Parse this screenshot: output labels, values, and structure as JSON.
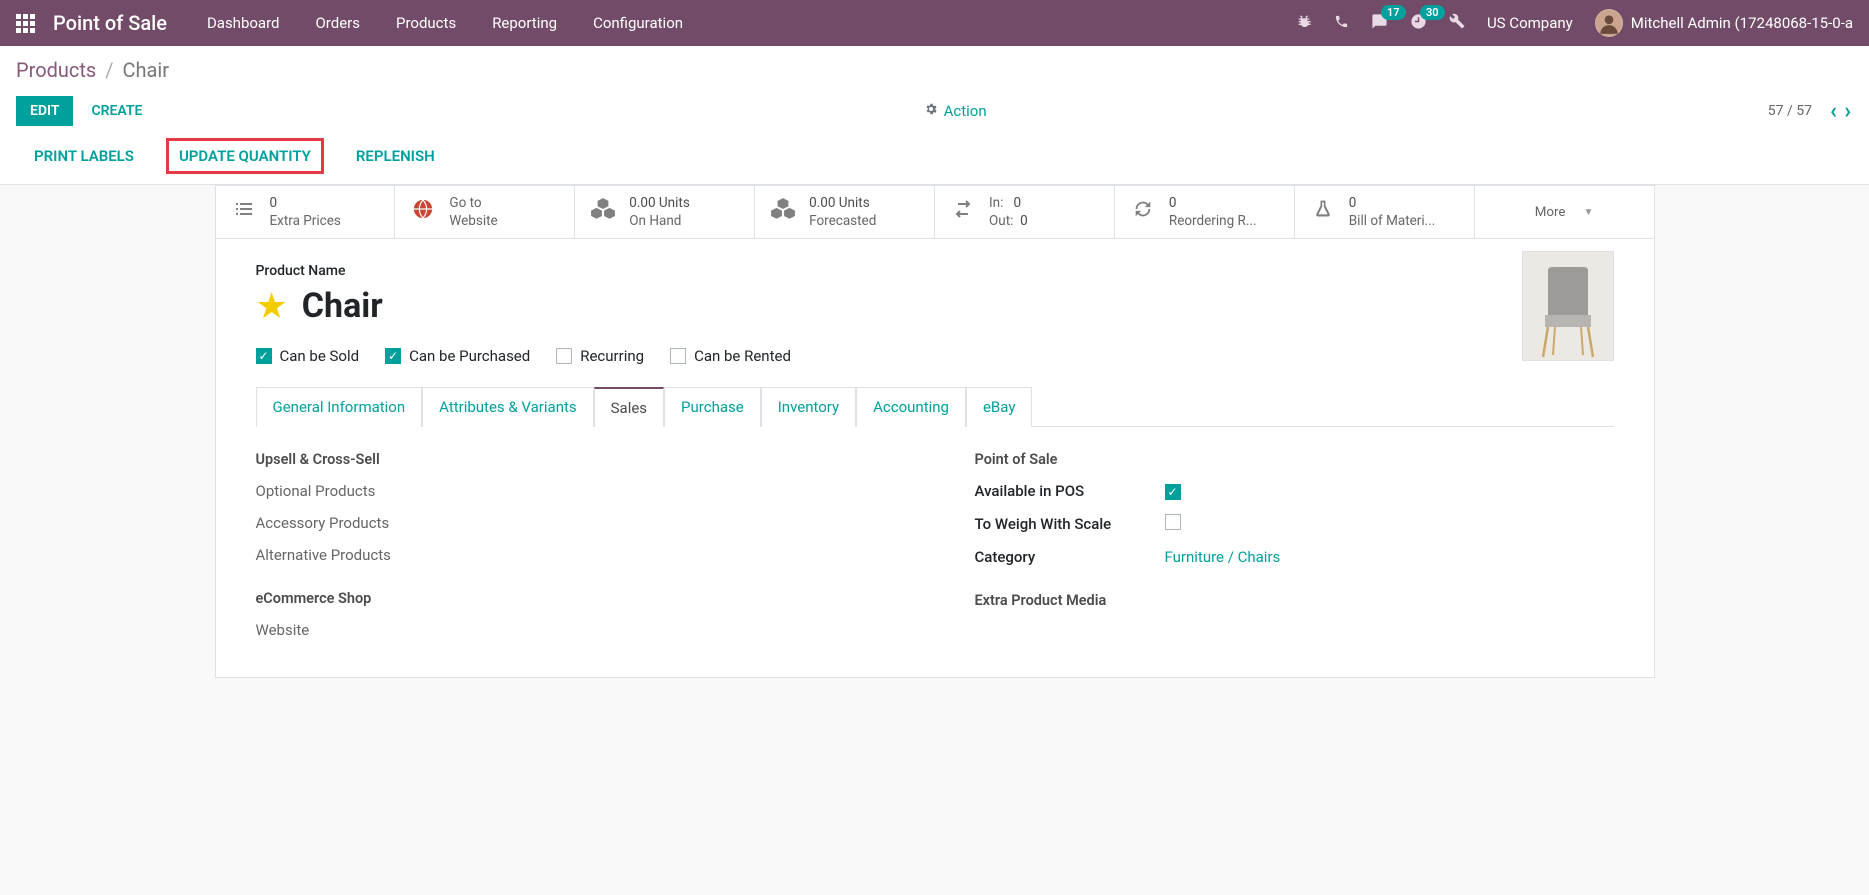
{
  "navbar": {
    "app_name": "Point of Sale",
    "menu": [
      "Dashboard",
      "Orders",
      "Products",
      "Reporting",
      "Configuration"
    ],
    "messages_badge": "17",
    "activities_badge": "30",
    "company": "US Company",
    "user": "Mitchell Admin (17248068-15-0-a"
  },
  "breadcrumb": {
    "parent": "Products",
    "current": "Chair"
  },
  "control_panel": {
    "edit": "EDIT",
    "create": "CREATE",
    "action": "Action",
    "pager": "57 / 57"
  },
  "status_buttons": {
    "print_labels": "PRINT LABELS",
    "update_quantity": "UPDATE QUANTITY",
    "replenish": "REPLENISH"
  },
  "stat_buttons": {
    "extra_prices": {
      "val": "0",
      "label": "Extra Prices"
    },
    "website": {
      "line1": "Go to",
      "line2": "Website"
    },
    "on_hand": {
      "val": "0.00 Units",
      "label": "On Hand"
    },
    "forecasted": {
      "val": "0.00 Units",
      "label": "Forecasted"
    },
    "transfers": {
      "in_label": "In:",
      "in_val": "0",
      "out_label": "Out:",
      "out_val": "0"
    },
    "reordering": {
      "val": "0",
      "label": "Reordering R..."
    },
    "bom": {
      "val": "0",
      "label": "Bill of Materi..."
    },
    "more": "More"
  },
  "product": {
    "name_label": "Product Name",
    "name": "Chair",
    "checks": {
      "sold": "Can be Sold",
      "purchased": "Can be Purchased",
      "recurring": "Recurring",
      "rented": "Can be Rented"
    }
  },
  "tabs": [
    "General Information",
    "Attributes & Variants",
    "Sales",
    "Purchase",
    "Inventory",
    "Accounting",
    "eBay"
  ],
  "sales_tab": {
    "left": {
      "section1": "Upsell & Cross-Sell",
      "optional": "Optional Products",
      "accessory": "Accessory Products",
      "alternative": "Alternative Products",
      "section2": "eCommerce Shop",
      "website": "Website"
    },
    "right": {
      "section1": "Point of Sale",
      "available_pos": "Available in POS",
      "weigh": "To Weigh With Scale",
      "category_label": "Category",
      "category_value": "Furniture / Chairs",
      "section2": "Extra Product Media"
    }
  }
}
